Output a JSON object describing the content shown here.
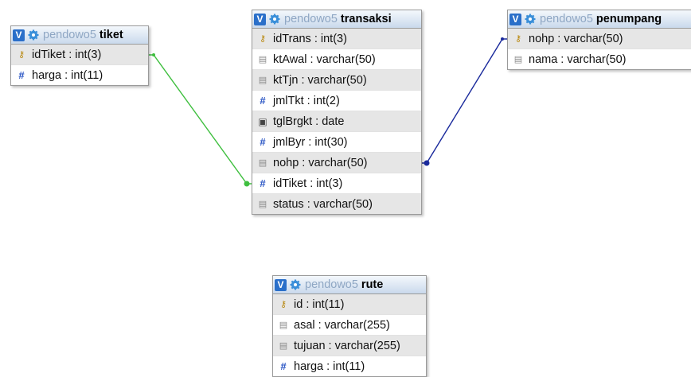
{
  "database": "pendowo5",
  "tables": [
    {
      "id": "tiket",
      "toggle": "V",
      "name": "tiket",
      "columns": [
        {
          "text": "idTiket : int(3)",
          "icon": "key-icon"
        },
        {
          "text": "harga : int(11)",
          "icon": "numeric-icon"
        }
      ]
    },
    {
      "id": "transaksi",
      "toggle": "V",
      "name": "transaksi",
      "columns": [
        {
          "text": "idTrans : int(3)",
          "icon": "key-icon"
        },
        {
          "text": "ktAwal : varchar(50)",
          "icon": "text-icon"
        },
        {
          "text": "ktTjn : varchar(50)",
          "icon": "text-icon"
        },
        {
          "text": "jmlTkt : int(2)",
          "icon": "numeric-icon"
        },
        {
          "text": "tglBrgkt : date",
          "icon": "date-icon"
        },
        {
          "text": "jmlByr : int(30)",
          "icon": "numeric-icon"
        },
        {
          "text": "nohp : varchar(50)",
          "icon": "text-icon"
        },
        {
          "text": "idTiket : int(3)",
          "icon": "numeric-icon"
        },
        {
          "text": "status : varchar(50)",
          "icon": "text-icon"
        }
      ]
    },
    {
      "id": "penumpang",
      "toggle": "V",
      "name": "penumpang",
      "columns": [
        {
          "text": "nohp : varchar(50)",
          "icon": "key-icon"
        },
        {
          "text": "nama : varchar(50)",
          "icon": "text-icon"
        }
      ]
    },
    {
      "id": "rute",
      "toggle": "V",
      "name": "rute",
      "columns": [
        {
          "text": "id : int(11)",
          "icon": "key-icon"
        },
        {
          "text": "asal : varchar(255)",
          "icon": "text-icon"
        },
        {
          "text": "tujuan : varchar(255)",
          "icon": "text-icon"
        },
        {
          "text": "harga : int(11)",
          "icon": "numeric-icon"
        }
      ]
    }
  ],
  "relations": [
    {
      "from": "tiket.idTiket",
      "to": "transaksi.idTiket",
      "color": "#3fbf3f"
    },
    {
      "from": "penumpang.nohp",
      "to": "transaksi.nohp",
      "color": "#1a2a9c"
    }
  ],
  "colors": {
    "header_gradient_top": "#f4f8fc",
    "header_gradient_bottom": "#c9d9ec",
    "toggle": "#2a6fc9",
    "db_name": "#8fa7c4",
    "row_alt": "#e6e6e6"
  }
}
